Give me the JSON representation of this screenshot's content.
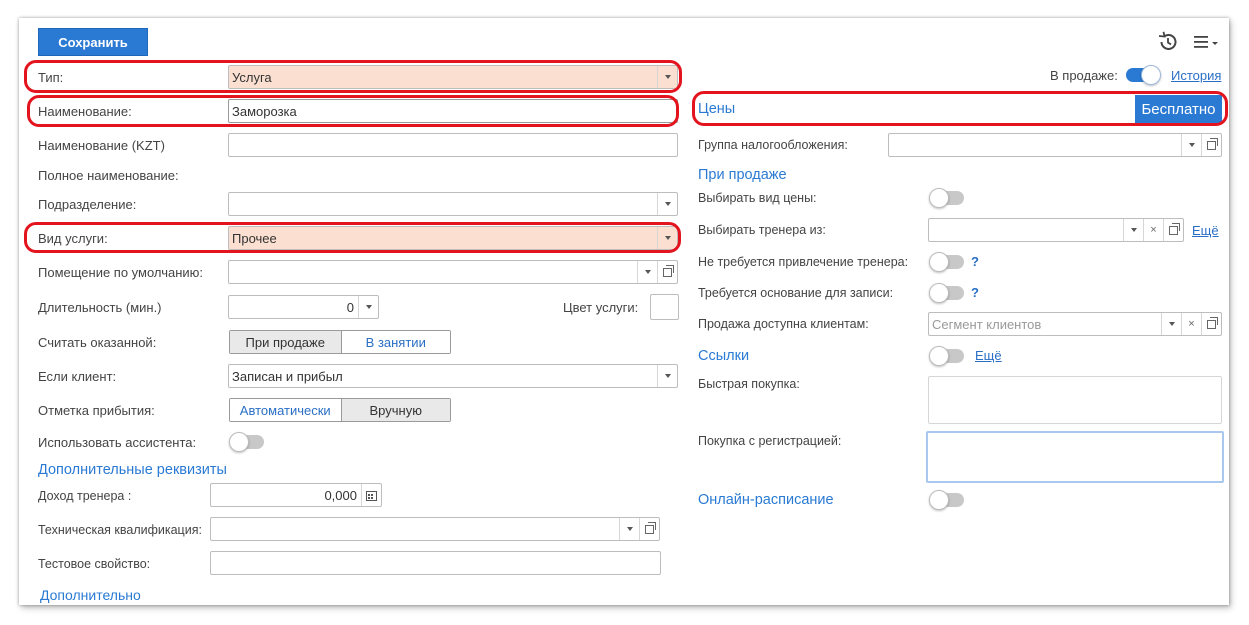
{
  "toolbar": {
    "save_label": "Сохранить"
  },
  "left": {
    "type": {
      "label": "Тип:",
      "value": "Услуга"
    },
    "name": {
      "label": "Наименование:",
      "value": "Заморозка"
    },
    "name_kzt": {
      "label": "Наименование (KZT)",
      "value": ""
    },
    "full_name": {
      "label": "Полное наименование:"
    },
    "subdivision": {
      "label": "Подразделение:",
      "value": ""
    },
    "service_kind": {
      "label": "Вид услуги:",
      "value": "Прочее"
    },
    "default_room": {
      "label": "Помещение по умолчанию:",
      "value": ""
    },
    "duration": {
      "label": "Длительность (мин.)",
      "value": "0"
    },
    "service_color": {
      "label": "Цвет услуги:"
    },
    "count_rendered": {
      "label": "Считать оказанной:",
      "options": [
        "При продаже",
        "В занятии"
      ],
      "selected": "При продаже"
    },
    "if_client": {
      "label": "Если клиент:",
      "value": "Записан и прибыл"
    },
    "arrival_mark": {
      "label": "Отметка прибытия:",
      "options": [
        "Автоматически",
        "Вручную"
      ],
      "selected": "Вручную"
    },
    "use_assistant": {
      "label": "Использовать ассистента:",
      "on": false
    },
    "extra_props_title": "Дополнительные реквизиты",
    "trainer_income": {
      "label": "Доход тренера :",
      "value": "0,000"
    },
    "tech_qualification": {
      "label": "Техническая квалификация:",
      "value": ""
    },
    "test_property": {
      "label": "Тестовое свойство:",
      "value": ""
    },
    "additional_title": "Дополнительно"
  },
  "right": {
    "on_sale": {
      "label": "В продаже:",
      "on": true
    },
    "history_link": "История",
    "prices_title": "Цены",
    "free_button": "Бесплатно",
    "tax_group": {
      "label": "Группа налогообложения:",
      "value": ""
    },
    "on_sale_title": "При продаже",
    "choose_price_kind": {
      "label": "Выбирать вид цены:",
      "on": false
    },
    "choose_trainer_from": {
      "label": "Выбирать тренера из:",
      "value": "",
      "more_link": "Ещё"
    },
    "no_trainer_needed": {
      "label": "Не требуется привлечение тренера:",
      "on": false,
      "help": "?"
    },
    "basis_required": {
      "label": "Требуется основание для записи:",
      "on": false,
      "help": "?"
    },
    "sale_available": {
      "label": "Продажа доступна клиентам:",
      "placeholder": "Сегмент клиентов"
    },
    "links_title": "Ссылки",
    "links_more": "Ещё",
    "quick_purchase": {
      "label": "Быстрая покупка:"
    },
    "purchase_with_registration": {
      "label": "Покупка с регистрацией:"
    },
    "online_schedule_title": "Онлайн-расписание"
  },
  "colors": {
    "accent": "#2a7ad3",
    "highlight": "#fbe0d2",
    "annotation": "#e3141e"
  },
  "icons": [
    "history-icon",
    "menu-icon",
    "calendar-icon",
    "open-icon",
    "clear-icon",
    "dropdown-icon"
  ]
}
